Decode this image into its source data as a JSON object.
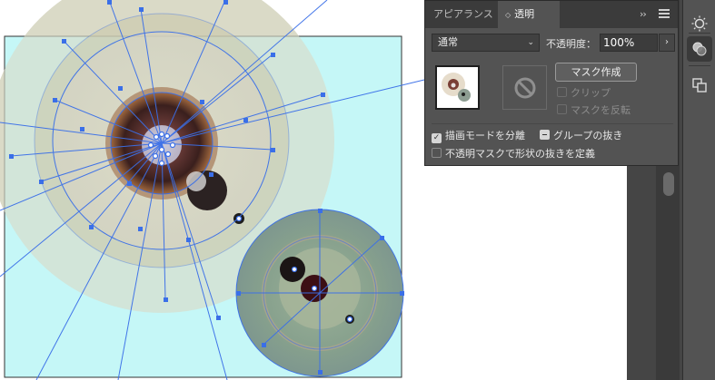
{
  "panel": {
    "tabs": [
      {
        "label": "アピアランス",
        "active": false
      },
      {
        "label": "透明",
        "active": true,
        "sort_glyph": "◇"
      }
    ],
    "collapse_glyph": "››",
    "blend_mode": {
      "value": "通常"
    },
    "opacity": {
      "label": "不透明度：",
      "value": "100%"
    },
    "make_mask_label": "マスク作成",
    "checkboxes": {
      "clip": {
        "label": "クリップ",
        "checked": false,
        "enabled": false
      },
      "invert_mask": {
        "label": "マスクを反転",
        "checked": false,
        "enabled": false
      },
      "isolate_blending": {
        "label": "描画モードを分離",
        "checked": true
      },
      "knockout_group": {
        "label": "グループの抜き",
        "state": "mixed"
      },
      "opacity_mask_define_knockout": {
        "label": "不透明マスクで形状の抜きを定義",
        "checked": false
      }
    }
  },
  "dock": {
    "icons": [
      "sun-icon",
      "transparency-icon",
      "pathfinder-icon"
    ]
  },
  "colors": {
    "panel_bg": "#535353",
    "tabbar_bg": "#3b3b3b",
    "selection_blue": "#3a6fe8",
    "artboard_cyan": "#c5f7f7"
  }
}
